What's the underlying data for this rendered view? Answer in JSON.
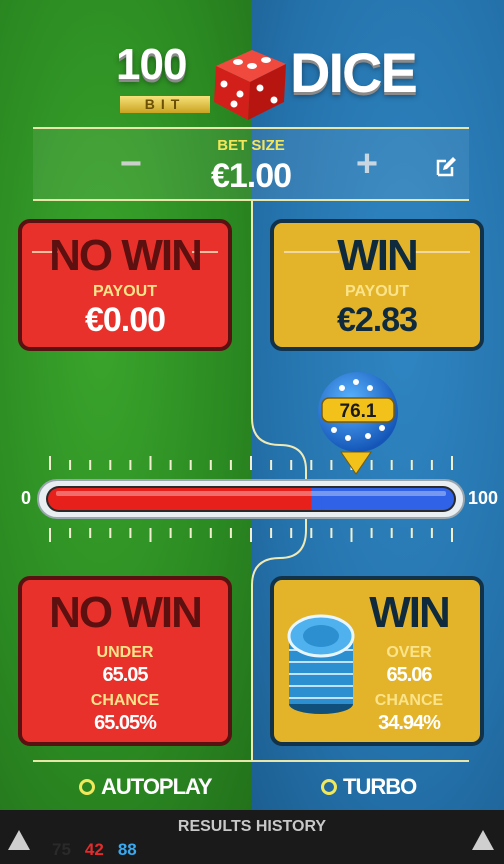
{
  "logo": {
    "number": "100",
    "bit": "BIT",
    "word": "DICE"
  },
  "bet": {
    "label": "BET SIZE",
    "value": "€1.00",
    "minus": "−",
    "plus": "+"
  },
  "top_left": {
    "title": "NO WIN",
    "sub": "PAYOUT",
    "value": "€0.00"
  },
  "top_right": {
    "title": "WIN",
    "sub": "PAYOUT",
    "value": "€2.83"
  },
  "slider": {
    "min_label": "0",
    "max_label": "100",
    "marker": "76.1",
    "split_value": 65.05,
    "marker_value": 76.1
  },
  "bottom_left": {
    "title": "NO WIN",
    "under_label": "UNDER",
    "under_value": "65.05",
    "chance_label": "CHANCE",
    "chance_value": "65.05%"
  },
  "bottom_right": {
    "title": "WIN",
    "over_label": "OVER",
    "over_value": "65.06",
    "chance_label": "CHANCE",
    "chance_value": "34.94%"
  },
  "options": {
    "autoplay": "AUTOPLAY",
    "turbo": "TURBO"
  },
  "history": {
    "title": "RESULTS HISTORY",
    "values": [
      {
        "v": "75",
        "color": "#2a2a2a"
      },
      {
        "v": "42",
        "color": "#e52b2b"
      },
      {
        "v": "88",
        "color": "#3aa9f0"
      }
    ]
  },
  "colors": {
    "green": "#2b8a22",
    "blue": "#2573ad",
    "red_panel": "#e8312b",
    "gold_panel": "#e3b42a"
  }
}
